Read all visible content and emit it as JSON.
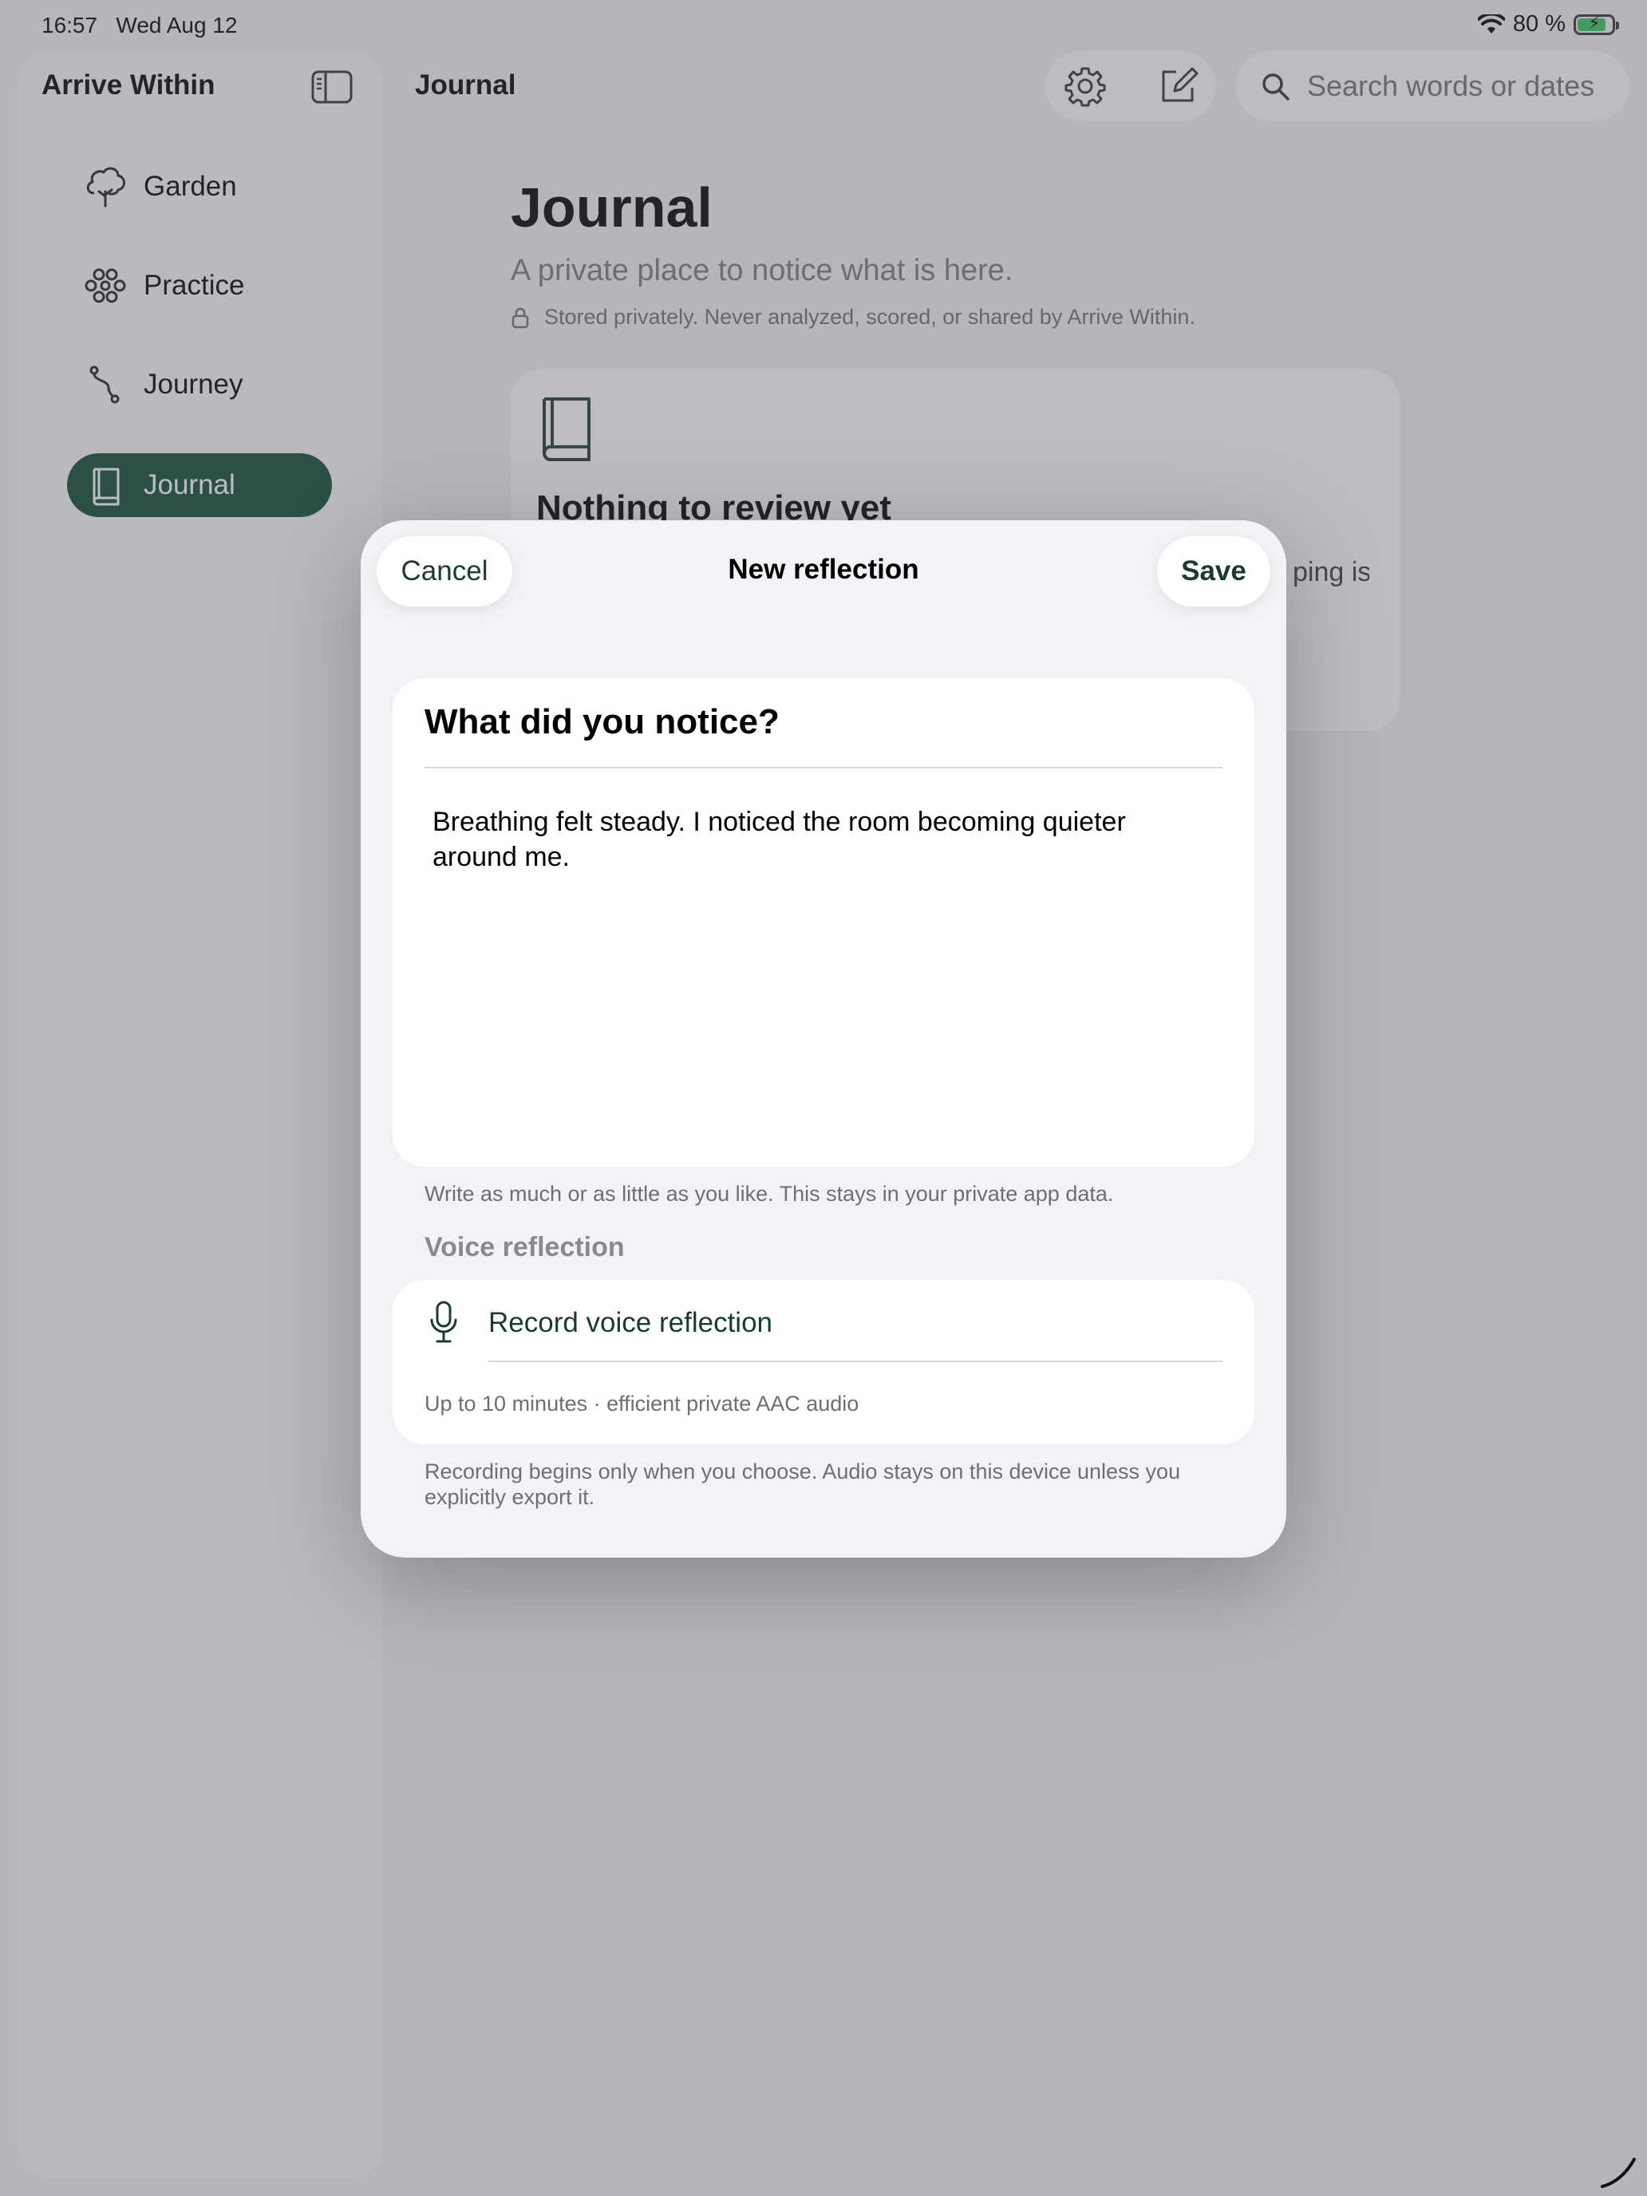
{
  "status_bar": {
    "time": "16:57",
    "date": "Wed Aug 12",
    "battery": "80 %",
    "battery_level": 0.8,
    "icons": [
      "wifi-icon",
      "battery-charging-icon"
    ]
  },
  "sidebar": {
    "app_title": "Arrive Within",
    "toggle_icon": "sidebar-toggle-icon",
    "items": [
      {
        "label": "Garden",
        "icon": "tree-icon",
        "active": false
      },
      {
        "label": "Practice",
        "icon": "flower-icon",
        "active": false
      },
      {
        "label": "Journey",
        "icon": "path-icon",
        "active": false
      },
      {
        "label": "Journal",
        "icon": "book-icon",
        "active": true
      }
    ]
  },
  "header": {
    "title": "Journal",
    "settings_icon": "gear-icon",
    "compose_icon": "compose-icon",
    "search_placeholder": "Search words or dates"
  },
  "page": {
    "title": "Journal",
    "subtitle": "A private place to notice what is here.",
    "privacy_note": "Stored privately. Never analyzed, scored, or shared by Arrive Within.",
    "empty_state": {
      "title": "Nothing to review yet",
      "body_fragment": "ping is"
    }
  },
  "sheet": {
    "title": "New reflection",
    "cancel_label": "Cancel",
    "save_label": "Save",
    "prompt": "What did you notice?",
    "reflection_text": "Breathing felt steady. I noticed the room becoming quieter around me.",
    "text_footnote": "Write as much or as little as you like. This stays in your private app data.",
    "voice_section_label": "Voice reflection",
    "record_label": "Record voice reflection",
    "voice_meta": "Up to 10 minutes · efficient private AAC audio",
    "voice_footnote": "Recording begins only when you choose. Audio stays on this device unless you explicitly export it."
  },
  "colors": {
    "accent": "#0f4a33",
    "accent_text": "#1c3b2f",
    "secondary_text": "#6e6e73",
    "background": "#f2f2f4"
  }
}
